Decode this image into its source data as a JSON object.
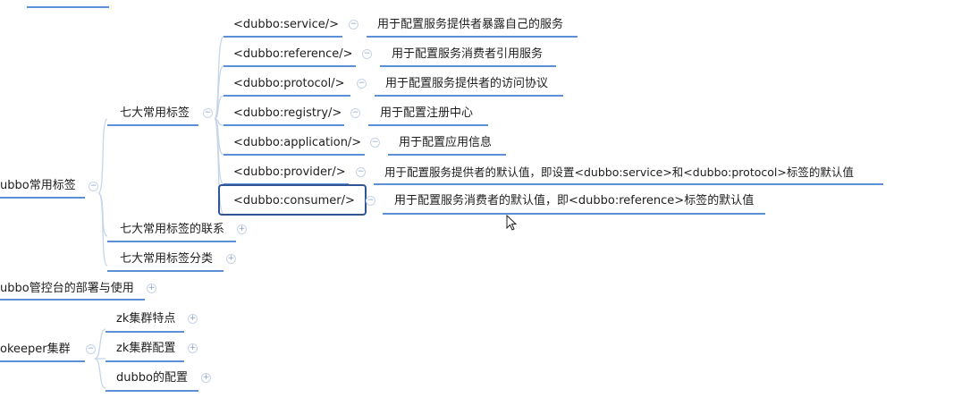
{
  "colors": {
    "branch": "#c5d5ea",
    "underline": "#5b8fd6",
    "underline_root": "#3f6fb5",
    "selection": "#2f5597",
    "toggle": "#c7d3e6"
  },
  "top_partial": "",
  "root": {
    "dubbo_tags": "ubbo常用标签"
  },
  "groups": {
    "seven_tags": "七大常用标签",
    "relation": "七大常用标签的联系",
    "classify": "七大常用标签分类"
  },
  "console": "ubbo管控台的部署与使用",
  "zookeeper": {
    "label": "okeeper集群",
    "children": [
      "zk集群特点",
      "zk集群配置",
      "dubbo的配置"
    ]
  },
  "tags": [
    {
      "tag": "<dubbo:service/>",
      "desc": "用于配置服务提供者暴露自己的服务"
    },
    {
      "tag": "<dubbo:reference/>",
      "desc": "用于配置服务消费者引用服务"
    },
    {
      "tag": "<dubbo:protocol/>",
      "desc": "用于配置服务提供者的访问协议"
    },
    {
      "tag": "<dubbo:registry/>",
      "desc": "用于配置注册中心"
    },
    {
      "tag": "<dubbo:application/>",
      "desc": "用于配置应用信息"
    },
    {
      "tag": "<dubbo:provider/>",
      "desc": "用于配置服务提供者的默认值，即设置<dubbo:service>和<dubbo:protocol>标签的默认值"
    },
    {
      "tag": "<dubbo:consumer/>",
      "desc": "用于配置服务消费者的默认值，即<dubbo:reference>标签的默认值"
    }
  ],
  "icons": {
    "collapse": "minus-circle-icon",
    "expand": "plus-circle-icon",
    "cursor": "mouse-pointer-icon"
  }
}
